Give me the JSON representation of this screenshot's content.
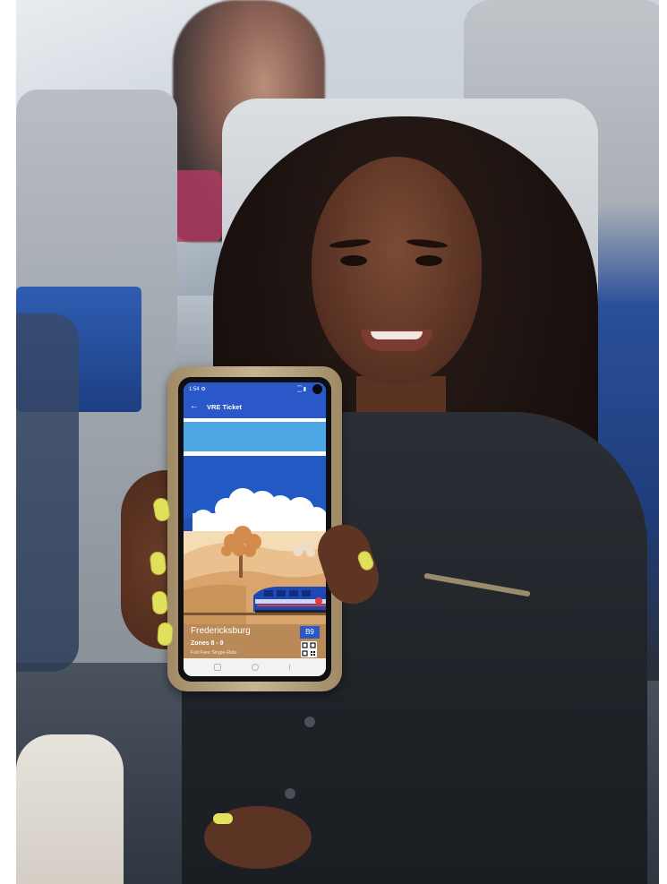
{
  "phone": {
    "status_time": "1:54 ⚙",
    "status_icons": "⁐ ▮",
    "app_title": "VRE Ticket",
    "back_glyph": "←",
    "ticket": {
      "station": "Fredericksburg",
      "zone_badge": "B9",
      "zones": "Zones 8 - 9",
      "fare_type": "Full Fare Single-Ride"
    }
  },
  "colors": {
    "app_blue": "#2a58c8",
    "banner_blue": "#4fa8e6",
    "ticket_tan": "#b98a57",
    "nail_yellow": "#e0e05a"
  }
}
